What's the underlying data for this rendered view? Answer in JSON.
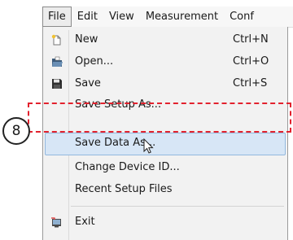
{
  "menubar": {
    "items": [
      {
        "label": "File"
      },
      {
        "label": "Edit"
      },
      {
        "label": "View"
      },
      {
        "label": "Measurement"
      },
      {
        "label": "Conf"
      }
    ]
  },
  "file_menu": {
    "items": [
      {
        "label": "New",
        "shortcut": "Ctrl+N",
        "icon": "new-file-icon"
      },
      {
        "label": "Open...",
        "shortcut": "Ctrl+O",
        "icon": "open-folder-icon"
      },
      {
        "label": "Save",
        "shortcut": "Ctrl+S",
        "icon": "save-disk-icon"
      },
      {
        "label": "Save Setup As..."
      },
      {
        "label": "Save Data As..."
      },
      {
        "label": "Change Device ID..."
      },
      {
        "label": "Recent Setup Files"
      },
      {
        "label": "Exit",
        "icon": "exit-icon"
      }
    ]
  },
  "callout": {
    "number": "8"
  },
  "colors": {
    "highlight_border": "#e2222e",
    "hover_background": "#d7e6f6"
  }
}
